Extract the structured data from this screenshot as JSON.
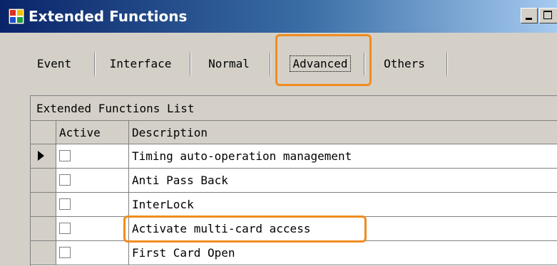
{
  "window": {
    "title": "Extended Functions",
    "highlight_color": "#f08c1e"
  },
  "tabs": [
    {
      "label": "Event",
      "active": false
    },
    {
      "label": "Interface",
      "active": false
    },
    {
      "label": "Normal",
      "active": false
    },
    {
      "label": "Advanced",
      "active": true
    },
    {
      "label": "Others",
      "active": false
    }
  ],
  "grid": {
    "caption": "Extended Functions List",
    "columns": [
      "Active",
      "Description"
    ],
    "current_row": 0,
    "highlighted_row": 3,
    "rows": [
      {
        "active": false,
        "description": "Timing auto-operation management"
      },
      {
        "active": false,
        "description": "Anti Pass Back"
      },
      {
        "active": false,
        "description": "InterLock"
      },
      {
        "active": false,
        "description": "Activate multi-card access"
      },
      {
        "active": false,
        "description": "First Card Open"
      }
    ]
  },
  "icons": {
    "app": "app-window-icon",
    "minimize": "minimize-icon",
    "maximize": "maximize-icon",
    "current_row": "row-pointer-icon"
  }
}
